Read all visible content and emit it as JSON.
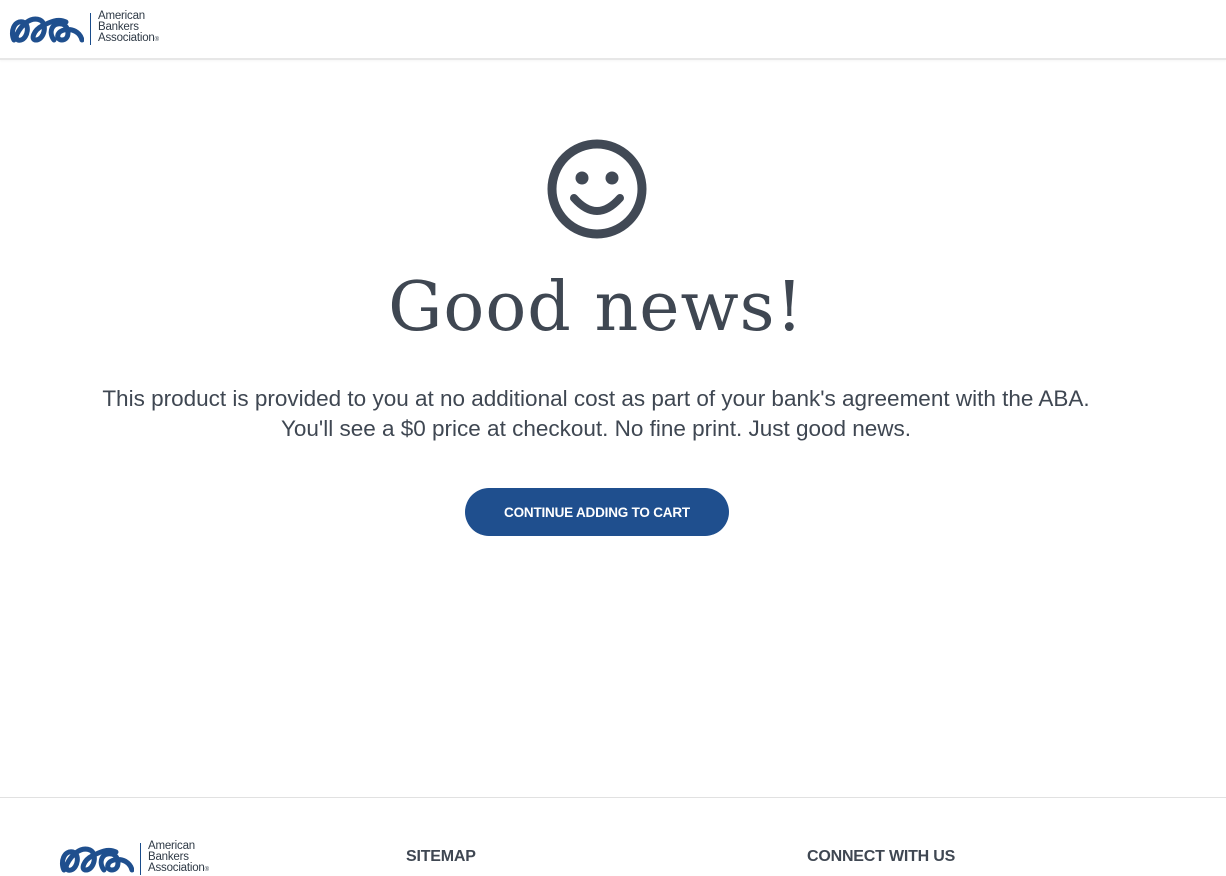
{
  "header": {
    "logo": {
      "line1": "American",
      "line2": "Bankers",
      "line3": "Association",
      "reg": "®"
    }
  },
  "main": {
    "icon": "smiley-icon",
    "headline": "Good news!",
    "message": "This product is provided to you at no additional cost as part of your bank's agreement with the ABA.  You'll see a $0 price at checkout. No fine print. Just good news.",
    "cta_label": "CONTINUE ADDING TO CART"
  },
  "footer": {
    "logo": {
      "line1": "American",
      "line2": "Bankers",
      "line3": "Association",
      "reg": "®"
    },
    "sitemap_heading": "SITEMAP",
    "connect_heading": "CONNECT WITH US"
  },
  "colors": {
    "brand_blue": "#1f4f8e",
    "text_gray": "#3f4752",
    "icon_gray": "#414955"
  }
}
